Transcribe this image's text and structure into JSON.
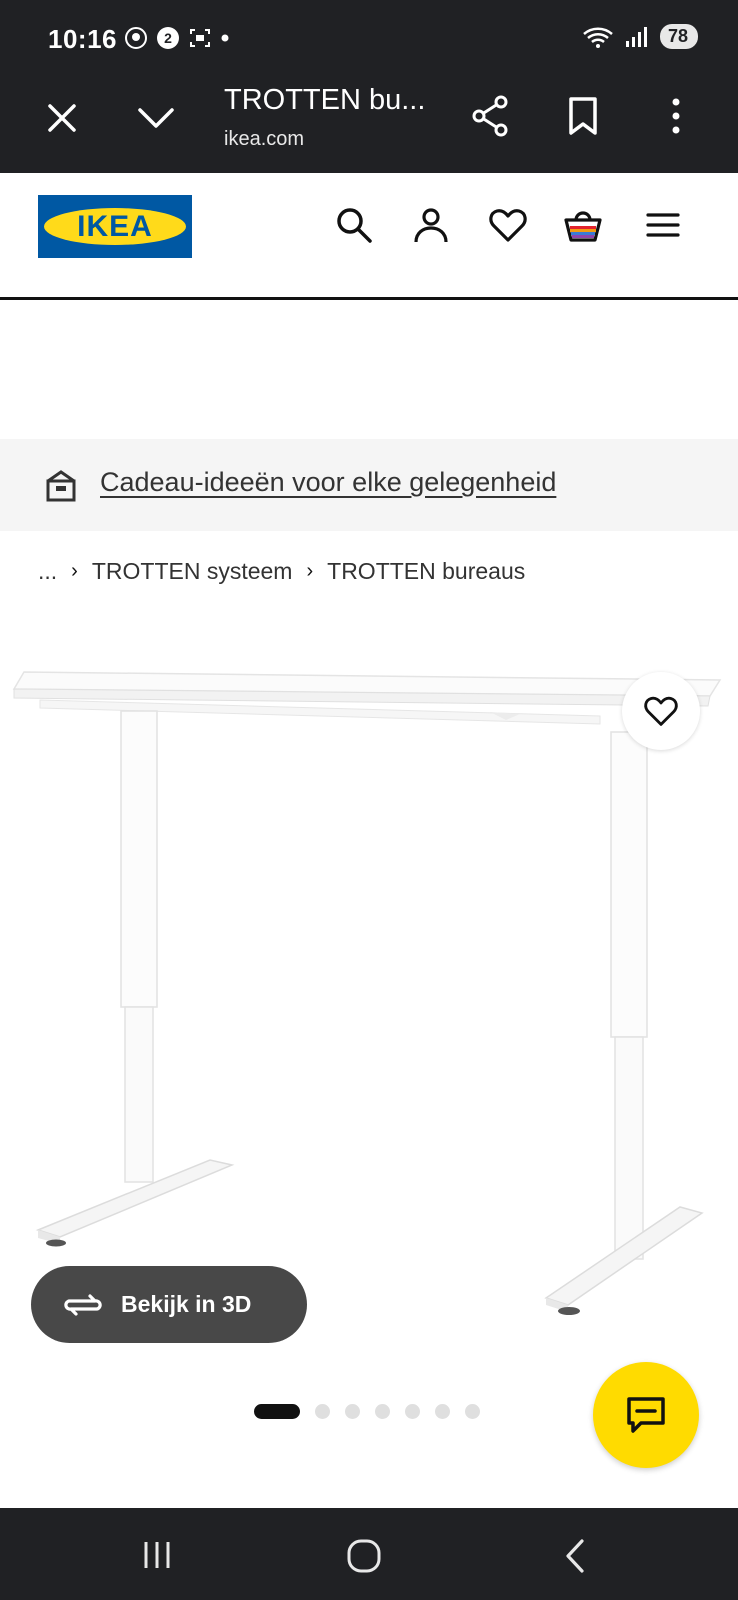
{
  "status": {
    "time": "10:16",
    "battery": "78"
  },
  "tab": {
    "title": "TROTTEN bu...",
    "url": "ikea.com"
  },
  "header": {
    "logo_text": "IKEA"
  },
  "promo": {
    "text": "Cadeau-ideeën voor elke gelegenheid"
  },
  "breadcrumb": {
    "ellipsis": "...",
    "items": [
      "TROTTEN systeem",
      "TROTTEN bureaus"
    ]
  },
  "product": {
    "view3d_label": "Bekijk in 3D",
    "gallery": {
      "count": 7,
      "active": 1
    }
  },
  "colors": {
    "ikea_blue": "#0058a3",
    "ikea_yellow": "#ffda1a",
    "chrome_dark": "#202124"
  }
}
